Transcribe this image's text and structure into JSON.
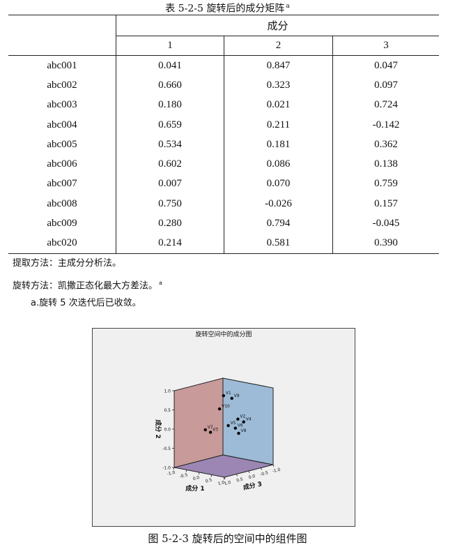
{
  "table": {
    "caption": "表 5-2-5  旋转后的成分矩阵",
    "caption_sup": "a",
    "group_header": "成分",
    "columns": [
      "1",
      "2",
      "3"
    ],
    "rows": [
      {
        "name": "abc001",
        "values": [
          "0.041",
          "0.847",
          "0.047"
        ]
      },
      {
        "name": "abc002",
        "values": [
          "0.660",
          "0.323",
          "0.097"
        ]
      },
      {
        "name": "abc003",
        "values": [
          "0.180",
          "0.021",
          "0.724"
        ]
      },
      {
        "name": "abc004",
        "values": [
          "0.659",
          "0.211",
          "-0.142"
        ]
      },
      {
        "name": "abc005",
        "values": [
          "0.534",
          "0.181",
          "0.362"
        ]
      },
      {
        "name": "abc006",
        "values": [
          "0.602",
          "0.086",
          "0.138"
        ]
      },
      {
        "name": "abc007",
        "values": [
          "0.007",
          "0.070",
          "0.759"
        ]
      },
      {
        "name": "abc008",
        "values": [
          "0.750",
          "-0.026",
          "0.157"
        ]
      },
      {
        "name": "abc009",
        "values": [
          "0.280",
          "0.794",
          "-0.045"
        ]
      },
      {
        "name": "abc020",
        "values": [
          "0.214",
          "0.581",
          "0.390"
        ]
      }
    ]
  },
  "notes": {
    "extraction": "提取方法：主成分分析法。",
    "rotation": "旋转方法：凯撒正态化最大方差法。",
    "rotation_sup": "a",
    "footnote": "a.旋转 5 次迭代后已收敛。"
  },
  "figure": {
    "title": "旋转空间中的成分图",
    "caption": "图 5-2-3  旋转后的空间中的组件图",
    "xlabel": "成分 1",
    "ylabel": "成分 2",
    "zlabel": "成分 3",
    "colors": {
      "left_wall": "#c89a9a",
      "back_wall": "#9dbbd6",
      "floor": "#9b86b4",
      "points": "#000000",
      "background": "#f0f0f0"
    }
  },
  "chart_data": {
    "type": "scatter",
    "title": "旋转空间中的成分图",
    "xlabel": "成分 1",
    "ylabel": "成分 2",
    "zlabel": "成分 3",
    "xlim": [
      -1.0,
      1.0
    ],
    "ylim": [
      -1.0,
      1.0
    ],
    "zlim": [
      -1.0,
      1.0
    ],
    "y_ticks": [
      "1.0",
      "0.5",
      "0.0",
      "-0.5",
      "-1.0"
    ],
    "x_ticks": [
      "-1.0",
      "-0.5",
      "0.0",
      "0.5",
      "1.0"
    ],
    "z_ticks": [
      "1.0",
      "0.5",
      "0.0",
      "-0.5",
      "-1.0"
    ],
    "points": [
      {
        "label": "V1",
        "x": 0.041,
        "y": 0.847,
        "z": 0.047
      },
      {
        "label": "V2",
        "x": 0.66,
        "y": 0.323,
        "z": 0.097
      },
      {
        "label": "V3",
        "x": 0.18,
        "y": 0.021,
        "z": 0.724
      },
      {
        "label": "V4",
        "x": 0.659,
        "y": 0.211,
        "z": -0.142
      },
      {
        "label": "V5",
        "x": 0.534,
        "y": 0.181,
        "z": 0.362
      },
      {
        "label": "V6",
        "x": 0.602,
        "y": 0.086,
        "z": 0.138
      },
      {
        "label": "V7",
        "x": 0.007,
        "y": 0.07,
        "z": 0.759
      },
      {
        "label": "V8",
        "x": 0.75,
        "y": -0.026,
        "z": 0.157
      },
      {
        "label": "V9",
        "x": 0.28,
        "y": 0.794,
        "z": -0.045
      },
      {
        "label": "V10",
        "x": 0.214,
        "y": 0.581,
        "z": 0.39
      }
    ]
  }
}
